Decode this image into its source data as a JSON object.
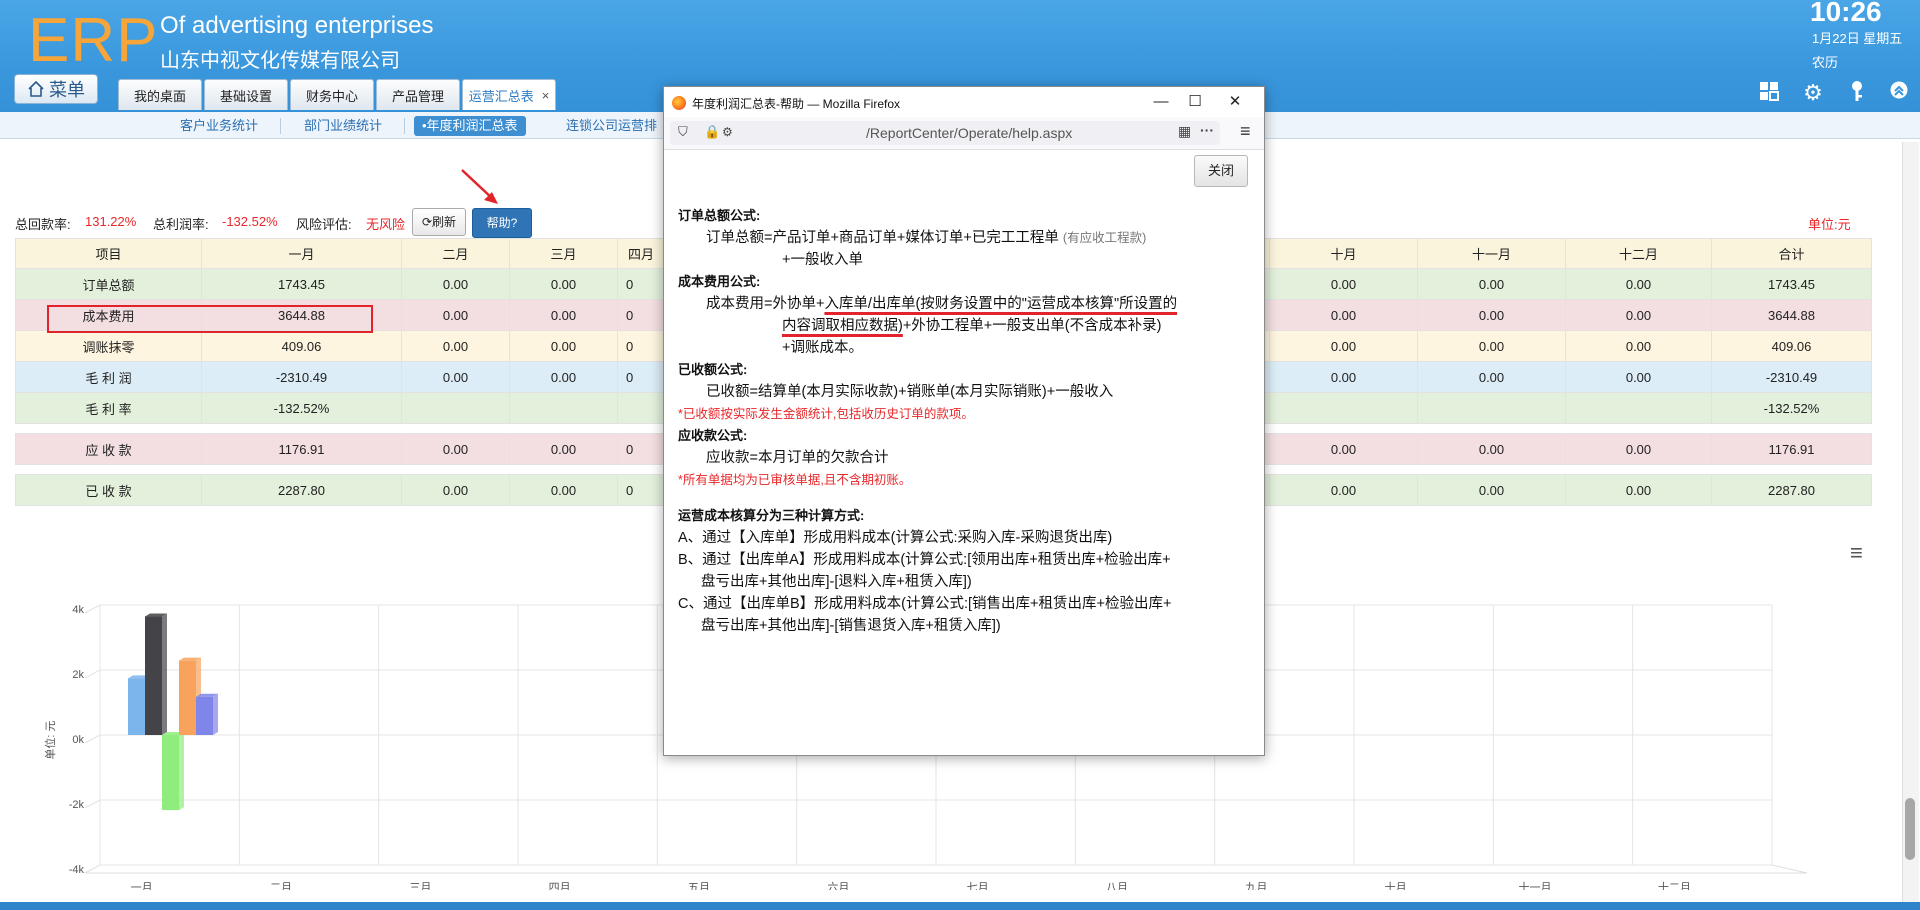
{
  "header": {
    "logo": "ERP",
    "company_en": "Of advertising enterprises",
    "company_cn": "山东中视文化传媒有限公司",
    "clock": "10:26",
    "date": "1月22日 星期五",
    "lunar": "农历",
    "menu_label": "菜单",
    "tabs": [
      {
        "label": "我的桌面"
      },
      {
        "label": "基础设置"
      },
      {
        "label": "财务中心"
      },
      {
        "label": "产品管理"
      },
      {
        "label": "运营汇总表",
        "close": "×"
      }
    ],
    "icons": [
      "layout-icon",
      "gear-icon",
      "key-icon",
      "collapse-icon"
    ]
  },
  "subnav": {
    "items": [
      "客户业务统计",
      "部门业绩统计",
      "•年度利润汇总表",
      "连锁公司运营排"
    ]
  },
  "summary": {
    "recovery_label": "总回款率:",
    "recovery_value": "131.22%",
    "profit_label": "总利润率:",
    "profit_value": "-132.52%",
    "risk_label": "风险评估:",
    "risk_value": "无风险",
    "refresh": "刷新",
    "help": "帮助?",
    "unit": "单位:元"
  },
  "table": {
    "headers": [
      "项目",
      "一月",
      "二月",
      "三月",
      "四月",
      "十月",
      "十一月",
      "十二月",
      "合计"
    ],
    "rows": [
      {
        "name": "订单总额",
        "cells": [
          "1743.45",
          "0.00",
          "0.00",
          "0",
          "0.00",
          "0.00",
          "0.00",
          "1743.45"
        ],
        "bg": "#e2f0dc"
      },
      {
        "name": "成本费用",
        "cells": [
          "3644.88",
          "0.00",
          "0.00",
          "0",
          "0.00",
          "0.00",
          "0.00",
          "3644.88"
        ],
        "bg": "#f3dfe1"
      },
      {
        "name": "调账抹零",
        "cells": [
          "409.06",
          "0.00",
          "0.00",
          "0",
          "0.00",
          "0.00",
          "0.00",
          "409.06"
        ],
        "bg": "#fdf5df"
      },
      {
        "name": "毛 利 润",
        "cells": [
          "-2310.49",
          "0.00",
          "0.00",
          "0",
          "0.00",
          "0.00",
          "0.00",
          "-2310.49"
        ],
        "bg": "#dcedf7"
      },
      {
        "name": "毛 利 率",
        "cells": [
          "-132.52%",
          "",
          "",
          "",
          "",
          "",
          "",
          "-132.52%"
        ],
        "bg": "#e2f0dc"
      },
      {
        "spacer": true
      },
      {
        "name": "应 收 款",
        "cells": [
          "1176.91",
          "0.00",
          "0.00",
          "0",
          "0.00",
          "0.00",
          "0.00",
          "1176.91"
        ],
        "bg": "#f3dfe1"
      },
      {
        "spacer": true
      },
      {
        "name": "已 收 款",
        "cells": [
          "2287.80",
          "0.00",
          "0.00",
          "0",
          "0.00",
          "0.00",
          "0.00",
          "2287.80"
        ],
        "bg": "#e2f0dc"
      }
    ]
  },
  "chart_data": {
    "type": "bar",
    "categories": [
      "一月",
      "二月",
      "三月",
      "四月",
      "五月",
      "六月",
      "七月",
      "八月",
      "九月",
      "十月",
      "十一月",
      "十二月"
    ],
    "ylabel": "单位: 元",
    "ylim": [
      -4000,
      4000
    ],
    "yticks": [
      "4k",
      "2k",
      "0k",
      "-2k",
      "-4k"
    ],
    "series": [
      {
        "values": [
          1743.45,
          0,
          0,
          0,
          0,
          0,
          0,
          0,
          0,
          0,
          0,
          0
        ],
        "color": "#7cb5ec"
      },
      {
        "values": [
          3644.88,
          0,
          0,
          0,
          0,
          0,
          0,
          0,
          0,
          0,
          0,
          0
        ],
        "color": "#434348"
      },
      {
        "values": [
          -2310.49,
          0,
          0,
          0,
          0,
          0,
          0,
          0,
          0,
          0,
          0,
          0
        ],
        "color": "#90ed7d"
      },
      {
        "values": [
          2287.8,
          0,
          0,
          0,
          0,
          0,
          0,
          0,
          0,
          0,
          0,
          0
        ],
        "color": "#f7a35c"
      },
      {
        "values": [
          1176.91,
          0,
          0,
          0,
          0,
          0,
          0,
          0,
          0,
          0,
          0,
          0
        ],
        "color": "#8085e9"
      }
    ],
    "grid": true
  },
  "popup": {
    "title": "年度利润汇总表-帮助 — Mozilla Firefox",
    "url": "/ReportCenter/Operate/help.aspx",
    "close_button": "关闭",
    "sections": {
      "order_title": "订单总额公式:",
      "order_line1": "订单总额=产品订单+商品订单+媒体订单+已完工工程单",
      "order_note": "(有应收工程款)",
      "order_line2": "+一般收入单",
      "cost_title": "成本费用公式:",
      "cost_line1a": "成本费用=外协单+",
      "cost_line1b": "入库单/出库单(按财务设置中的\"运营成本核算\"所设置的",
      "cost_line2a": "内容调取相应数据)",
      "cost_line2b": "+外协工程单+一般支出单(不含成本补录)",
      "cost_line3": "+调账成本。",
      "received_title": "已收额公式:",
      "received_line": "已收额=结算单(本月实际收款)+销账单(本月实际销账)+一般收入",
      "received_note": "*已收额按实际发生金额统计,包括收历史订单的款项。",
      "receivable_title": "应收款公式:",
      "receivable_line": "应收款=本月订单的欠款合计",
      "receivable_note": "*所有单据均为已审核单据,且不含期初账。",
      "method_title": "运营成本核算分为三种计算方式:",
      "method_a": "A、通过【入库单】形成用料成本(计算公式:采购入库-采购退货出库)",
      "method_b1": "B、通过【出库单A】形成用料成本(计算公式:[领用出库+租赁出库+检验出库+",
      "method_b2": "盘亏出库+其他出库]-[退料入库+租赁入库])",
      "method_c1": "C、通过【出库单B】形成用料成本(计算公式:[销售出库+租赁出库+检验出库+",
      "method_c2": "盘亏出库+其他出库]-[销售退货入库+租赁入库])"
    }
  }
}
